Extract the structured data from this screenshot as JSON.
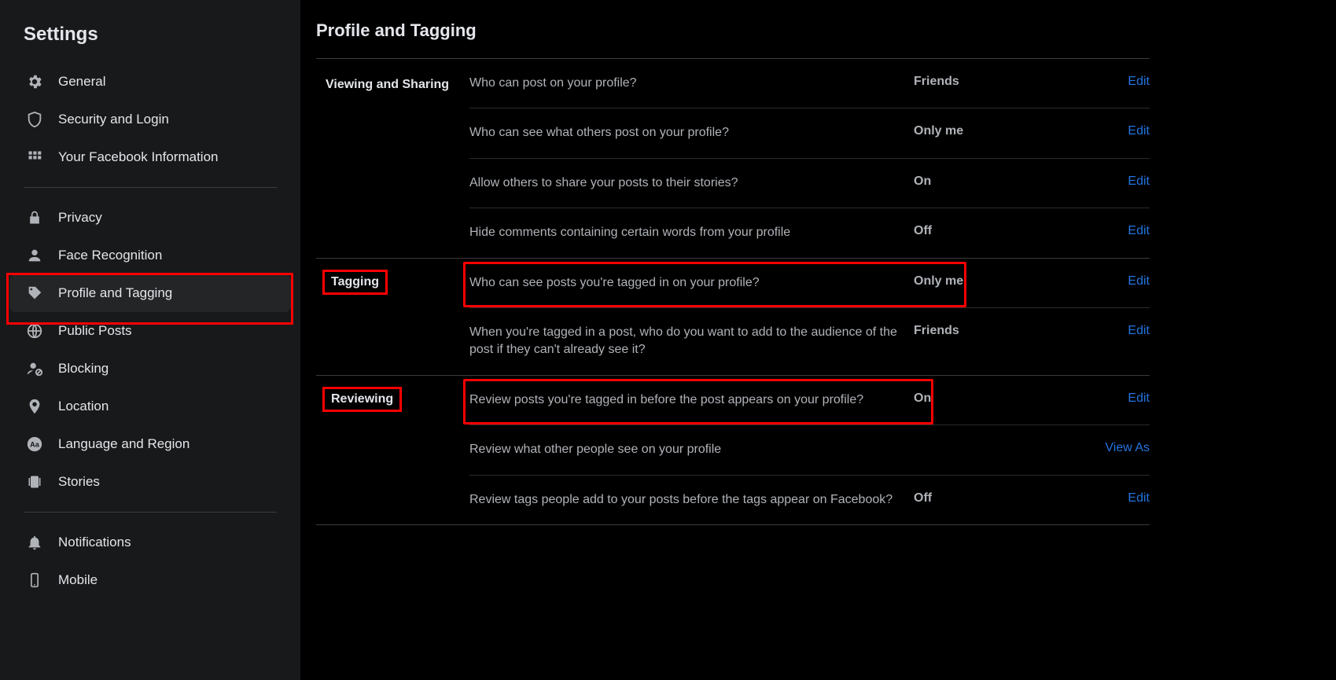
{
  "sidebar": {
    "title": "Settings",
    "items": [
      {
        "label": "General"
      },
      {
        "label": "Security and Login"
      },
      {
        "label": "Your Facebook Information"
      },
      {
        "label": "Privacy"
      },
      {
        "label": "Face Recognition"
      },
      {
        "label": "Profile and Tagging"
      },
      {
        "label": "Public Posts"
      },
      {
        "label": "Blocking"
      },
      {
        "label": "Location"
      },
      {
        "label": "Language and Region"
      },
      {
        "label": "Stories"
      },
      {
        "label": "Notifications"
      },
      {
        "label": "Mobile"
      }
    ]
  },
  "page": {
    "title": "Profile and Tagging",
    "edit_label": "Edit",
    "viewas_label": "View As",
    "sections": [
      {
        "label": "Viewing and Sharing",
        "rows": [
          {
            "q": "Who can post on your profile?",
            "v": "Friends",
            "a": "Edit"
          },
          {
            "q": "Who can see what others post on your profile?",
            "v": "Only me",
            "a": "Edit"
          },
          {
            "q": "Allow others to share your posts to their stories?",
            "v": "On",
            "a": "Edit"
          },
          {
            "q": "Hide comments containing certain words from your profile",
            "v": "Off",
            "a": "Edit"
          }
        ]
      },
      {
        "label": "Tagging",
        "rows": [
          {
            "q": "Who can see posts you're tagged in on your profile?",
            "v": "Only me",
            "a": "Edit"
          },
          {
            "q": "When you're tagged in a post, who do you want to add to the audience of the post if they can't already see it?",
            "v": "Friends",
            "a": "Edit"
          }
        ]
      },
      {
        "label": "Reviewing",
        "rows": [
          {
            "q": "Review posts you're tagged in before the post appears on your profile?",
            "v": "On",
            "a": "Edit"
          },
          {
            "q": "Review what other people see on your profile",
            "v": "",
            "a": "View As"
          },
          {
            "q": "Review tags people add to your posts before the tags appear on Facebook?",
            "v": "Off",
            "a": "Edit"
          }
        ]
      }
    ]
  }
}
